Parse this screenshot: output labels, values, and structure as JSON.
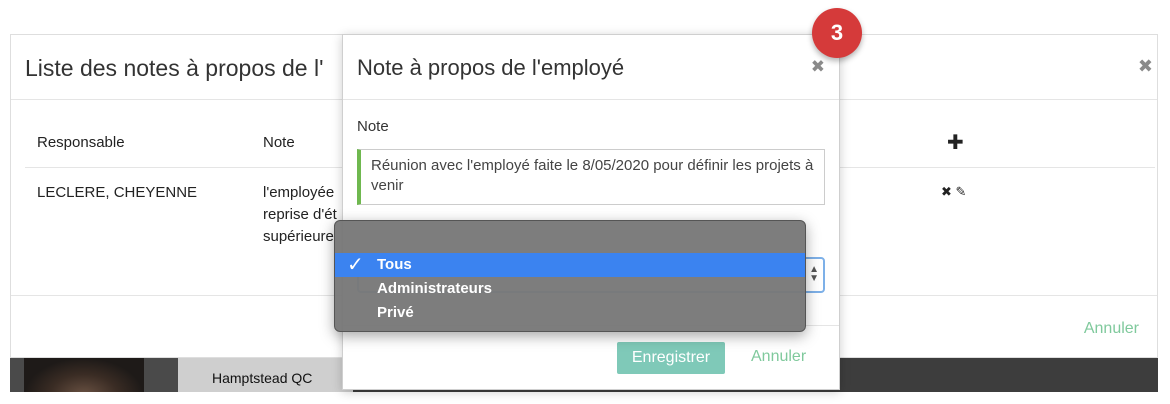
{
  "background": {
    "city_text": "Hamptstead QC"
  },
  "list_modal": {
    "title": "Liste des notes à propos de l'",
    "close_icon": "close-icon",
    "columns": [
      "Responsable",
      "Note"
    ],
    "add_icon": "plus-icon",
    "rows": [
      {
        "responsable": "LECLERE, CHEYENNE",
        "note_lines": [
          "l'employée",
          "reprise d'ét",
          "supérieure"
        ]
      }
    ],
    "row_action_icons": [
      "delete-icon",
      "edit-icon"
    ],
    "cancel_label": "Annuler"
  },
  "note_modal": {
    "title": "Note à propos de l'employé",
    "close_icon": "close-icon",
    "note_label": "Note",
    "note_value": "Réunion avec l'employé faite le 8/05/2020 pour définir les projets à venir",
    "save_label": "Enregistrer",
    "cancel_label": "Annuler"
  },
  "visibility_dropdown": {
    "options": [
      "Tous",
      "Administrateurs",
      "Privé"
    ],
    "selected": "Tous"
  },
  "step_badge": "3",
  "colors": {
    "accent_green": "#7fc99c",
    "save_button": "#7fc9b8",
    "badge_red": "#d53a3a",
    "selected_blue": "#3b83f0"
  }
}
